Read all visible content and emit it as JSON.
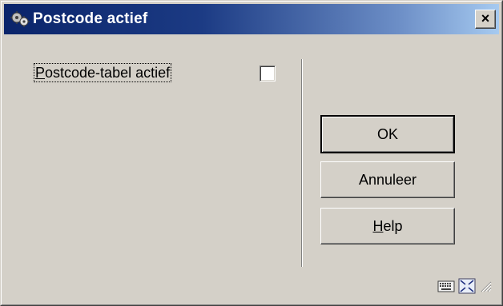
{
  "window": {
    "title": "Postcode actief",
    "app_icon": "gears-icon",
    "close_label": "×"
  },
  "form": {
    "label_first": "P",
    "label_rest": "ostcode-tabel actief",
    "checkbox_checked": false
  },
  "buttons": {
    "ok_label": "OK",
    "cancel_label": "Annuleer",
    "help_first": "H",
    "help_rest": "elp"
  },
  "statusbar": {
    "icons": [
      "keyboard-icon",
      "fullscreen-icon",
      "resize-grip-icon"
    ]
  },
  "colors": {
    "title_gradient_start": "#0a246a",
    "title_gradient_end": "#a6caf0",
    "face": "#d4d0c8"
  }
}
